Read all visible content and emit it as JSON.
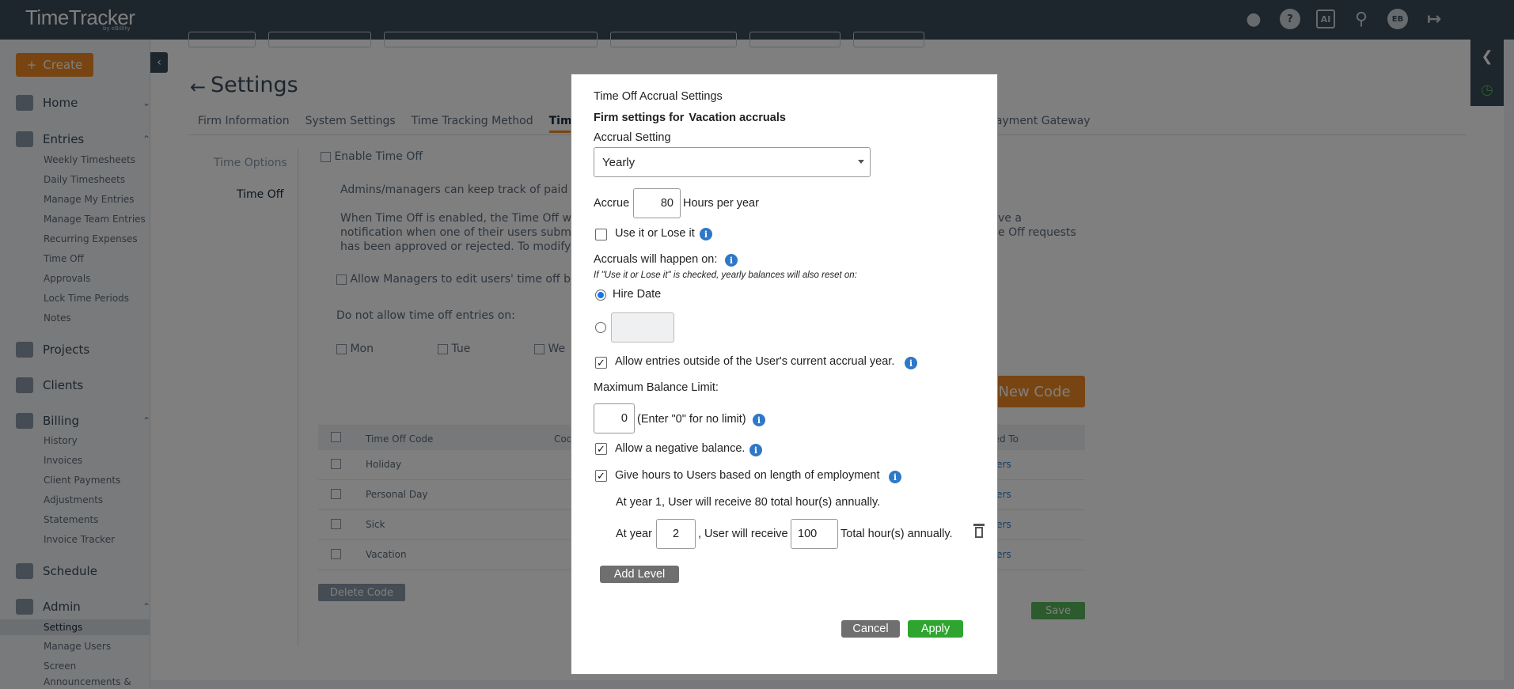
{
  "app": {
    "logo": "TimeTracker",
    "logo_sub": "by eBillity"
  },
  "header": {
    "icons": [
      "bell-icon",
      "help-icon",
      "ai-icon",
      "search-icon",
      "user-avatar",
      "logout-icon"
    ],
    "help_glyph": "?",
    "ai_glyph": "AI",
    "avatar_initials": "EB"
  },
  "sidebar": {
    "create_label": "Create",
    "sections": [
      {
        "label": "Home"
      },
      {
        "label": "Entries",
        "items": [
          "Weekly Timesheets",
          "Daily Timesheets",
          "Manage My Entries",
          "Manage Team Entries",
          "Recurring Expenses",
          "Time Off",
          "Approvals",
          "Lock Time Periods",
          "Notes"
        ]
      },
      {
        "label": "Projects"
      },
      {
        "label": "Clients"
      },
      {
        "label": "Billing",
        "items": [
          "History",
          "Invoices",
          "Client Payments",
          "Adjustments",
          "Statements",
          "Invoice Tracker"
        ]
      },
      {
        "label": "Schedule"
      },
      {
        "label": "Admin",
        "items": [
          "Settings",
          "Manage Users",
          "Screen",
          "Announcements &"
        ]
      }
    ]
  },
  "main": {
    "page_title": "Settings",
    "tabs": [
      "Firm Information",
      "System Settings",
      "Time Tracking Method",
      "Timer Se"
    ],
    "tab_right": "Payment Gateway",
    "subnav": [
      "Time Options",
      "Time Off"
    ],
    "enable_time_off": "Enable Time Off",
    "desc1": "Admins/managers can keep track of paid and",
    "desc2": "When Time Off is enabled, the Time Off widg",
    "desc3": "notification when one of their users submits",
    "desc4": "has been approved or rejected. To modify th",
    "desc_right1": "ve a",
    "desc_right2": "e Off requests",
    "allow_managers": "Allow Managers to edit users' time off bala",
    "do_not_allow": "Do not allow time off entries on:",
    "days": [
      "Mon",
      "Tue",
      "We"
    ],
    "new_code": "New Code",
    "table": {
      "headers": [
        "Time Off Code",
        "Cod",
        "igned To"
      ],
      "rows": [
        {
          "name": "Holiday",
          "assigned": "l Users"
        },
        {
          "name": "Personal Day",
          "assigned": "l Users"
        },
        {
          "name": "Sick",
          "assigned": "l Users"
        },
        {
          "name": "Vacation",
          "assigned": "l Users"
        }
      ]
    },
    "delete_code": "Delete Code",
    "save": "Save"
  },
  "modal": {
    "title": "Time Off Accrual Settings",
    "firm_prefix": "Firm settings for",
    "firm_type": "Vacation",
    "firm_suffix": "accruals",
    "accrual_setting_label": "Accrual Setting",
    "accrual_setting_value": "Yearly",
    "accrue_label": "Accrue",
    "accrue_value": "80",
    "accrue_unit": "Hours per year",
    "use_it_or_lose_it": "Use it or Lose it",
    "accruals_happen_on": "Accruals will happen on:",
    "note": "If \"Use it or Lose it\" is checked, yearly balances will also reset on:",
    "hire_date": "Hire Date",
    "custom_date_value": "",
    "allow_outside": "Allow entries outside of the User's current accrual year.",
    "max_balance_label": "Maximum Balance Limit:",
    "max_balance_value": "0",
    "max_balance_hint": "(Enter \"0\" for no limit)",
    "allow_negative": "Allow a negative balance.",
    "give_hours": "Give hours to Users based on length of employment",
    "year1_text": "At year 1, User will receive 80 total hour(s) annually.",
    "at_year_label": "At year",
    "at_year_value": "2",
    "will_receive_label": ", User will receive",
    "will_receive_value": "100",
    "total_label": "Total hour(s) annually.",
    "add_level": "Add Level",
    "cancel": "Cancel",
    "apply": "Apply",
    "checks": {
      "use_it_or_lose_it": false,
      "allow_outside": true,
      "allow_negative": true,
      "give_hours": true
    },
    "radio_selected": "hire_date",
    "colors": {
      "apply": "#2fa530",
      "cancel": "#6f6f6f",
      "info": "#2e78c7"
    }
  }
}
